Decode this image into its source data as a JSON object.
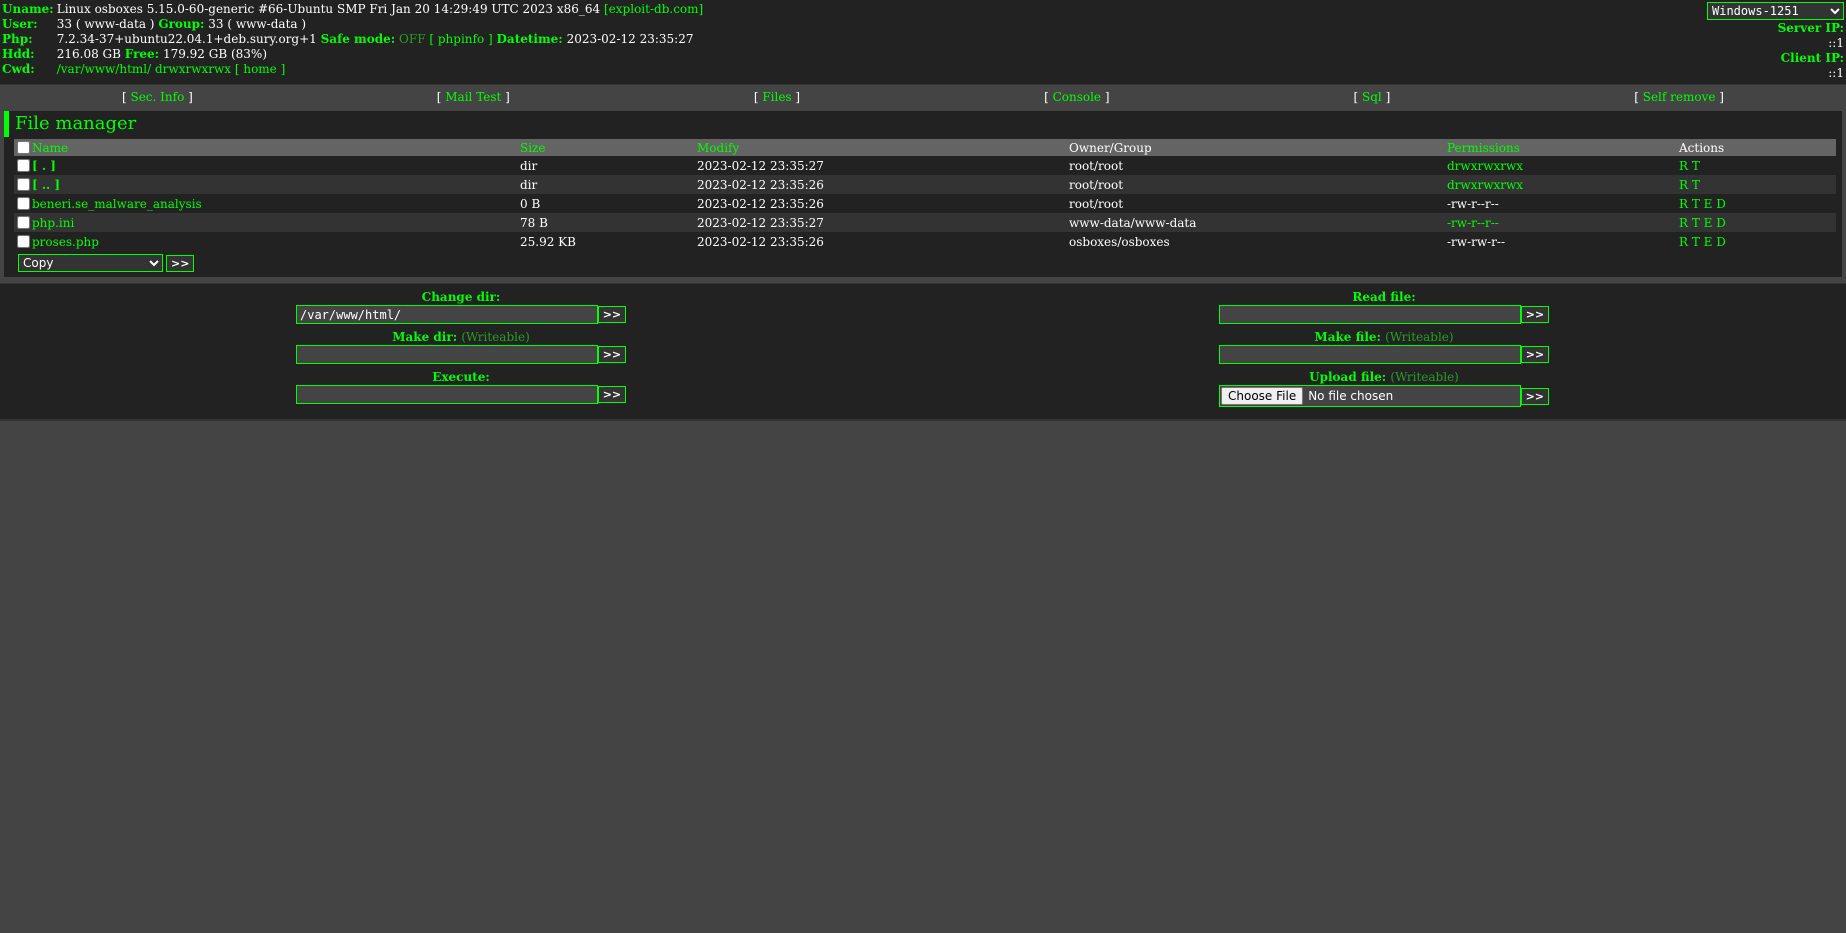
{
  "header": {
    "uname_label": "Uname:",
    "uname_value": "Linux osboxes 5.15.0-60-generic #66-Ubuntu SMP Fri Jan 20 14:29:49 UTC 2023 x86_64",
    "uname_link": "[exploit-db.com]",
    "user_label": "User:",
    "user_value": "33 ( www-data )",
    "group_label": "Group:",
    "group_value": "33 ( www-data )",
    "php_label": "Php:",
    "php_value": "7.2.34-37+ubuntu22.04.1+deb.sury.org+1",
    "safe_mode_label": "Safe mode:",
    "safe_mode_value": "OFF",
    "phpinfo_link": "[ phpinfo ]",
    "datetime_label": "Datetime:",
    "datetime_value": "2023-02-12 23:35:27",
    "hdd_label": "Hdd:",
    "hdd_value": "216.08 GB",
    "free_label": "Free:",
    "free_value": "179.92 GB (83%)",
    "cwd_label": "Cwd:",
    "cwd_path": "/var/www/html/",
    "cwd_perms": "drwxrwxrwx",
    "cwd_home": "[ home ]",
    "charset_selected": "Windows-1251",
    "server_ip_label": "Server IP:",
    "server_ip_value": "::1",
    "client_ip_label": "Client IP:",
    "client_ip_value": "::1"
  },
  "menu": [
    {
      "label": "Sec. Info"
    },
    {
      "label": "Mail Test"
    },
    {
      "label": "Files"
    },
    {
      "label": "Console"
    },
    {
      "label": "Sql"
    },
    {
      "label": "Self remove"
    }
  ],
  "file_manager": {
    "title": "File manager",
    "columns": {
      "name": "Name",
      "size": "Size",
      "modify": "Modify",
      "owner": "Owner/Group",
      "permissions": "Permissions",
      "actions": "Actions"
    },
    "rows": [
      {
        "name": "[ . ]",
        "size": "dir",
        "modify": "2023-02-12 23:35:27",
        "owner": "root/root",
        "perms": "drwxrwxrwx",
        "actions": "R T"
      },
      {
        "name": "[ .. ]",
        "size": "dir",
        "modify": "2023-02-12 23:35:26",
        "owner": "root/root",
        "perms": "drwxrwxrwx",
        "actions": "R T"
      },
      {
        "name": "beneri.se_malware_analysis",
        "size": "0 B",
        "modify": "2023-02-12 23:35:26",
        "owner": "root/root",
        "perms": "-rw-r--r--",
        "actions": "R T E D"
      },
      {
        "name": "php.ini",
        "size": "78 B",
        "modify": "2023-02-12 23:35:27",
        "owner": "www-data/www-data",
        "perms": "-rw-r--r--",
        "actions": "R T E D"
      },
      {
        "name": "proses.php",
        "size": "25.92 KB",
        "modify": "2023-02-12 23:35:26",
        "owner": "osboxes/osboxes",
        "perms": "-rw-rw-r--",
        "actions": "R T E D"
      }
    ],
    "action_selected": "Copy",
    "go_label": ">>"
  },
  "forms": {
    "change_dir_title": "Change dir:",
    "change_dir_value": "/var/www/html/",
    "make_dir_title": "Make dir:",
    "make_dir_note": "(Writeable)",
    "execute_title": "Execute:",
    "read_file_title": "Read file:",
    "make_file_title": "Make file:",
    "make_file_note": "(Writeable)",
    "upload_file_title": "Upload file:",
    "upload_file_note": "(Writeable)",
    "choose_file_label": "Choose File",
    "no_file_label": "No file chosen",
    "go_label": ">>"
  },
  "colors": {
    "accent": "#00ff00",
    "dim_accent": "#23a023",
    "header_bg": "#222222",
    "page_bg": "#444444"
  }
}
